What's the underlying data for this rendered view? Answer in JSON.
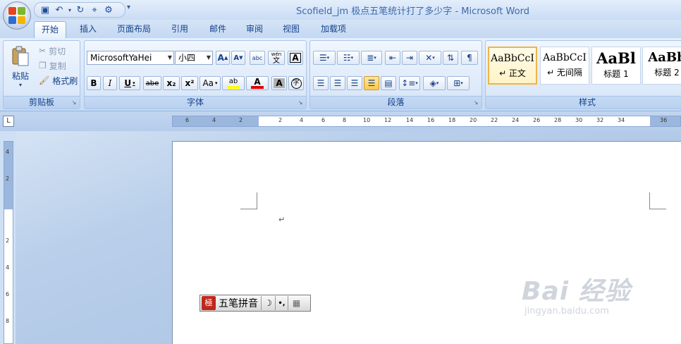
{
  "window": {
    "title": "Scofield_jm 极点五笔统计打了多少字 - Microsoft Word",
    "office_logo_colors": [
      "#e8441c",
      "#7bb82a",
      "#2b6fd6",
      "#f4b400"
    ]
  },
  "qat": {
    "items": [
      "save-icon",
      "undo-icon",
      "redo-icon",
      "format-painter-icon",
      "customize-icon"
    ]
  },
  "tabs": [
    {
      "label": "开始",
      "active": true
    },
    {
      "label": "插入"
    },
    {
      "label": "页面布局"
    },
    {
      "label": "引用"
    },
    {
      "label": "邮件"
    },
    {
      "label": "审阅"
    },
    {
      "label": "视图"
    },
    {
      "label": "加载项"
    }
  ],
  "clipboard": {
    "group_label": "剪贴板",
    "paste": "粘贴",
    "cut": "剪切",
    "copy": "复制",
    "format_painter": "格式刷"
  },
  "font": {
    "group_label": "字体",
    "family": "MicrosoftYaHei",
    "size": "小四",
    "grow": "A",
    "shrink": "A",
    "clear_format": "abc",
    "phonetic": "wén",
    "phonetic_char": "文",
    "border_char": "A",
    "bold": "B",
    "italic": "I",
    "underline": "U",
    "strike": "abe",
    "subscript": "x₂",
    "superscript": "x²",
    "case": "Aa",
    "highlight": "ab",
    "highlight_color": "#ffff00",
    "font_color_letter": "A",
    "font_color": "#e00000",
    "shade_char": "A",
    "enclose_char": "字"
  },
  "paragraph": {
    "group_label": "段落"
  },
  "styles": {
    "group_label": "样式",
    "items": [
      {
        "sample": "AaBbCcI",
        "name": "↵ 正文",
        "selected": true
      },
      {
        "sample": "AaBbCcI",
        "name": "↵ 无间隔"
      },
      {
        "sample": "AaBl",
        "name": "标题 1"
      },
      {
        "sample": "AaBb",
        "name": "标题 2"
      }
    ]
  },
  "ruler": {
    "left_labels": [
      "6",
      "4",
      "2"
    ],
    "right_labels": [
      "2",
      "4",
      "6",
      "8",
      "10",
      "12",
      "14",
      "16",
      "18",
      "20",
      "22",
      "24",
      "26",
      "28",
      "30",
      "32",
      "34",
      "36"
    ],
    "vertical_labels": [
      "4",
      "2",
      "",
      "2",
      "4",
      "6",
      "8"
    ]
  },
  "document": {
    "paragraph_mark": "↵"
  },
  "ime": {
    "logo_char": "極",
    "mode": "五笔拼音",
    "moon": "☽",
    "punct": "•,",
    "keyboard": "▦"
  },
  "watermark": {
    "main": "Bai 经验",
    "sub": "jingyan.baidu.com"
  }
}
